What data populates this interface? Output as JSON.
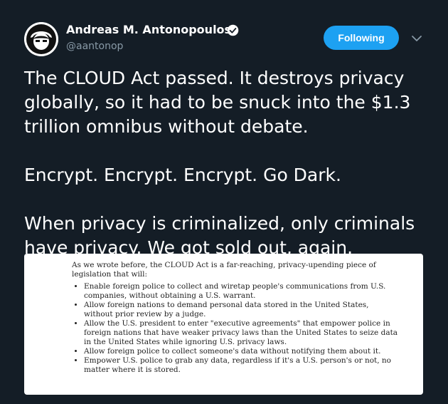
{
  "author": {
    "name": "Andreas M. Antonopoulos",
    "handle": "@aantonop",
    "verified_icon": "verified-badge-icon"
  },
  "actions": {
    "follow_label": "Following",
    "menu_icon": "chevron-down-icon"
  },
  "tweet": {
    "text": "The CLOUD Act passed. It destroys privacy globally, so it had to be snuck into the $1.3 trillion omnibus without debate.\n\nEncrypt. Encrypt. Encrypt. Go Dark.\n\n When privacy is criminalized, only criminals have privacy. We got sold out, again."
  },
  "quote_image": {
    "intro": "As we wrote before, the CLOUD Act is a far-reaching, privacy-upending piece of legislation that will:",
    "bullets": [
      "Enable foreign police to collect and wiretap people's communications from U.S. companies, without obtaining a U.S. warrant.",
      "Allow foreign nations to demand personal data stored in the United States, without prior review by a judge.",
      "Allow the U.S. president to enter \"executive agreements\" that empower police in foreign nations that have weaker privacy laws than the United States to seize data in the United States while ignoring U.S. privacy laws.",
      "Allow foreign police to collect someone's data without notifying them about it.",
      "Empower U.S. police to grab any data, regardless if it's a U.S. person's or not, no matter where it is stored."
    ]
  },
  "colors": {
    "background": "#141d26",
    "accent": "#1da1f2",
    "secondary_text": "#8899a6"
  }
}
